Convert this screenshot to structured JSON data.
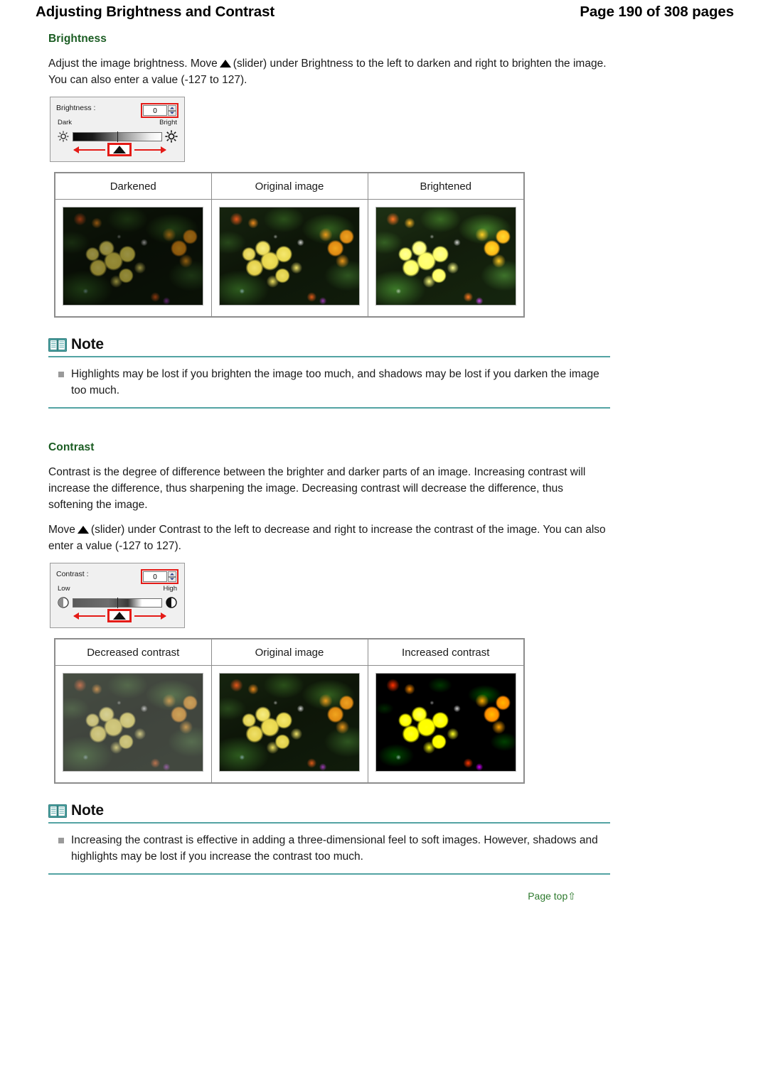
{
  "header": {
    "title": "Adjusting Brightness and Contrast",
    "page_indicator": "Page 190 of 308 pages"
  },
  "brightness_section": {
    "heading": "Brightness",
    "paragraph_part1": "Adjust the image brightness. Move",
    "paragraph_part2": "(slider) under Brightness to the left to darken and right to brighten the image. You can also enter a value (-127 to 127).",
    "control": {
      "label": "Brightness :",
      "value": "0",
      "left_end_label": "Dark",
      "right_end_label": "Bright",
      "left_icon": "dim-sun-icon",
      "right_icon": "bright-sun-icon",
      "spinner_up": "spinner-up-icon",
      "spinner_down": "spinner-down-icon"
    },
    "table": {
      "headers": [
        "Darkened",
        "Original image",
        "Brightened"
      ],
      "image_alts": [
        "darkened-flower-photo",
        "original-flower-photo",
        "brightened-flower-photo"
      ]
    },
    "note": {
      "icon": "book-icon",
      "title": "Note",
      "text": "Highlights may be lost if you brighten the image too much, and shadows may be lost if you darken the image too much."
    }
  },
  "contrast_section": {
    "heading": "Contrast",
    "paragraph1": "Contrast is the degree of difference between the brighter and darker parts of an image. Increasing contrast will increase the difference, thus sharpening the image. Decreasing contrast will decrease the difference, thus softening the image.",
    "paragraph2_part1": "Move",
    "paragraph2_part2": "(slider) under Contrast to the left to decrease and right to increase the contrast of the image. You can also enter a value (-127 to 127).",
    "control": {
      "label": "Contrast :",
      "value": "0",
      "left_end_label": "Low",
      "right_end_label": "High",
      "left_icon": "low-contrast-icon",
      "right_icon": "high-contrast-icon",
      "spinner_up": "spinner-up-icon",
      "spinner_down": "spinner-down-icon"
    },
    "table": {
      "headers": [
        "Decreased contrast",
        "Original image",
        "Increased contrast"
      ],
      "image_alts": [
        "decreased-contrast-flower-photo",
        "original-flower-photo",
        "increased-contrast-flower-photo"
      ]
    },
    "note": {
      "icon": "book-icon",
      "title": "Note",
      "text": "Increasing the contrast is effective in adding a three-dimensional feel to soft images. However, shadows and highlights may be lost if you increase the contrast too much."
    }
  },
  "footer": {
    "page_top_label": "Page top",
    "page_top_arrow": "⇧"
  },
  "colors": {
    "heading_green": "#1a5c22",
    "note_rule_teal": "#53a3a3",
    "annotation_red": "#e41b17",
    "link_green": "#2d7a2d",
    "table_border_gray": "#8c8c8c"
  }
}
